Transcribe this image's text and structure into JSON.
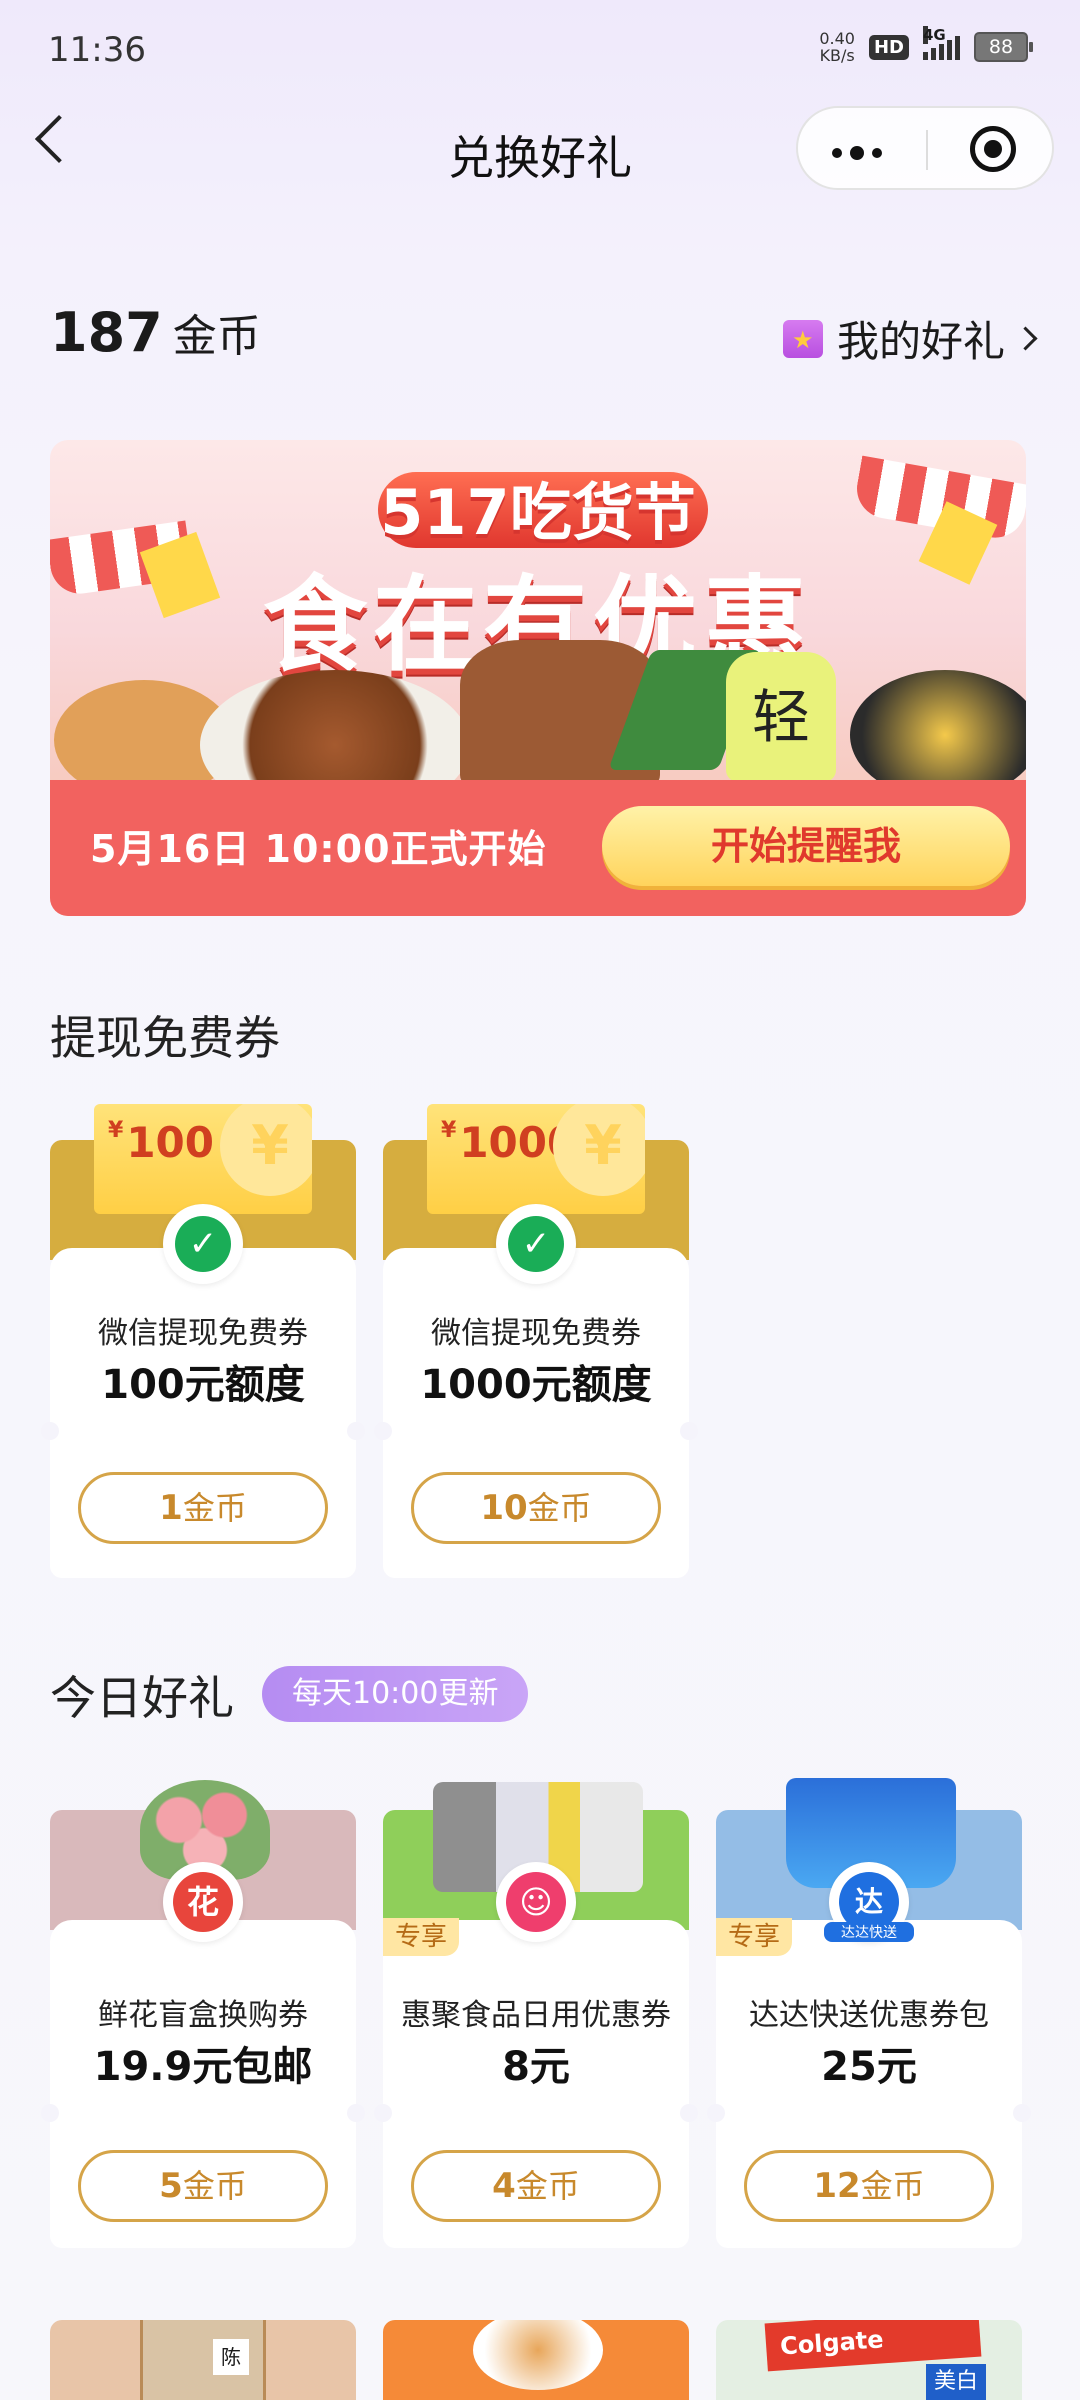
{
  "status_bar": {
    "time": "11:36",
    "net_speed_value": "0.40",
    "net_speed_unit": "KB/s",
    "hd": "HD",
    "network": "4G",
    "battery": "88"
  },
  "nav": {
    "title": "兑换好礼"
  },
  "header": {
    "coins": "187",
    "coin_unit": "金币",
    "my_gifts": "我的好礼"
  },
  "banner": {
    "festival": "517吃货节",
    "headline": "食在有优惠",
    "date_text": "5月16日  10:00正式开始",
    "remind_button": "开始提醒我",
    "bottle_text": "轻"
  },
  "withdraw_section": {
    "title": "提现免费券",
    "cards": [
      {
        "ticket_currency": "¥",
        "ticket_value": "100",
        "yen": "¥",
        "name": "微信提现免费券",
        "value": "100元额度",
        "price_num": "1",
        "price_unit": "金币"
      },
      {
        "ticket_currency": "¥",
        "ticket_value": "1000",
        "yen": "¥",
        "name": "微信提现免费券",
        "value": "1000元额度",
        "price_num": "10",
        "price_unit": "金币"
      }
    ]
  },
  "today_section": {
    "title": "今日好礼",
    "update_badge": "每天10:00更新",
    "cards": [
      {
        "name": "鲜花盲盒换购券",
        "value": "19.9元包邮",
        "price_num": "5",
        "price_unit": "金币",
        "brand_icon_text": "花",
        "exclusive": ""
      },
      {
        "name": "惠聚食品日用优惠券",
        "value": "8元",
        "price_num": "4",
        "price_unit": "金币",
        "brand_icon_text": "☺",
        "exclusive": "专享"
      },
      {
        "name": "达达快送优惠券包",
        "value": "25元",
        "price_num": "12",
        "price_unit": "金币",
        "brand_icon_text": "达",
        "exclusive": "专享",
        "brand_label": "达达快送"
      }
    ]
  },
  "next_row_labels": [
    "陈",
    "Colgate",
    "美白"
  ],
  "colors": {
    "accent_gold": "#d5a448",
    "banner_red": "#f2625f",
    "purple_badge": "#b58cf2",
    "wechat_green": "#1aad57"
  }
}
